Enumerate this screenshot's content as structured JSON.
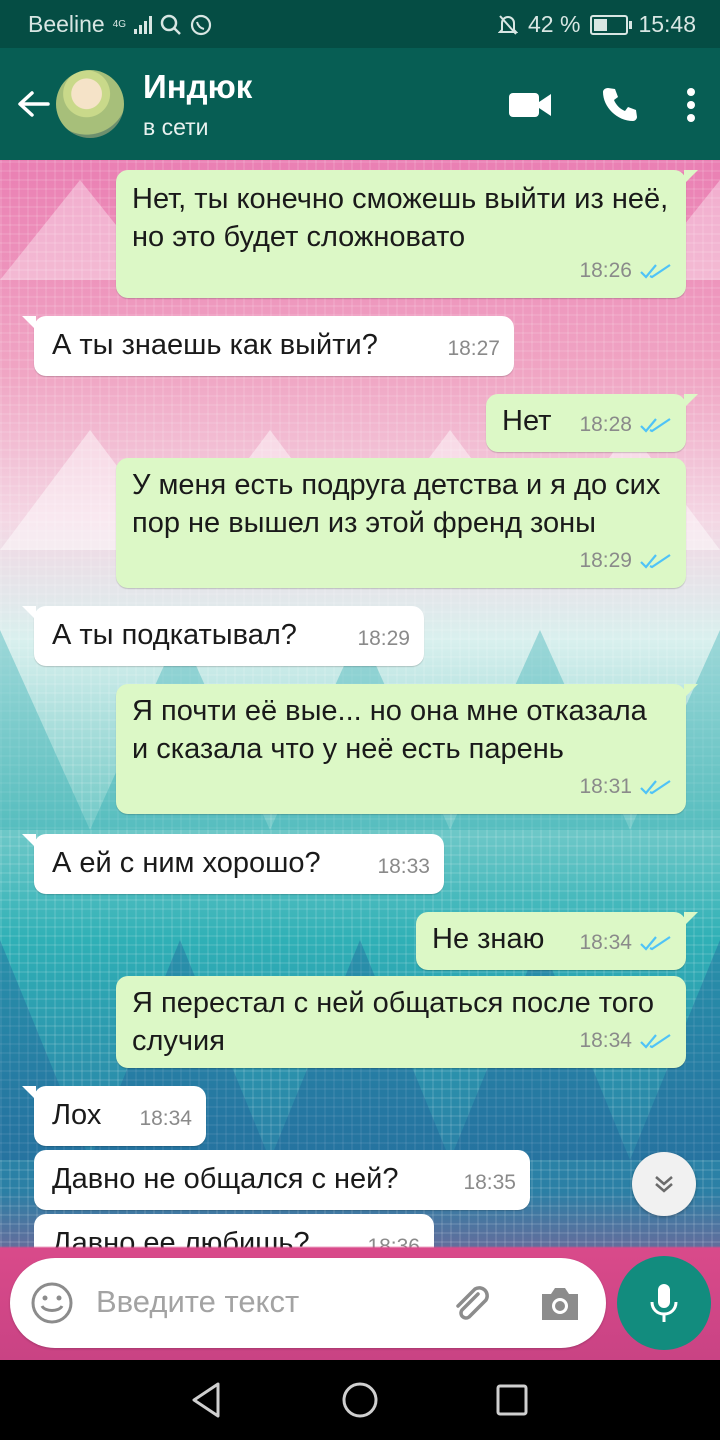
{
  "statusbar": {
    "carrier": "Beeline",
    "network": "4G",
    "battery": "42 %",
    "battery_fraction": 0.42,
    "time": "15:48"
  },
  "header": {
    "contact_name": "Индюк",
    "contact_status": "в сети"
  },
  "messages": [
    {
      "dir": "out",
      "text": "Нет, ты конечно сможешь выйти из неё, но это будет сложновато",
      "time": "18:26",
      "read": true
    },
    {
      "dir": "in",
      "text": "А ты знаешь как выйти?",
      "time": "18:27"
    },
    {
      "dir": "out",
      "text": "Нет",
      "time": "18:28",
      "read": true
    },
    {
      "dir": "out",
      "text": "У меня есть подруга детства и я до сих пор не вышел из этой френд зоны",
      "time": "18:29",
      "read": true
    },
    {
      "dir": "in",
      "text": "А ты подкатывал?",
      "time": "18:29"
    },
    {
      "dir": "out",
      "text": "Я почти её вые... но она мне отказала и сказала что у неё есть парень",
      "time": "18:31",
      "read": true
    },
    {
      "dir": "in",
      "text": "А ей с ним хорошо?",
      "time": "18:33"
    },
    {
      "dir": "out",
      "text": "Не знаю",
      "time": "18:34",
      "read": true
    },
    {
      "dir": "out",
      "text": "Я перестал с ней общаться после того случия",
      "time": "18:34",
      "read": true
    },
    {
      "dir": "in",
      "text": "Лох",
      "time": "18:34"
    },
    {
      "dir": "in",
      "text": "Давно не общался с ней?",
      "time": "18:35"
    },
    {
      "dir": "in",
      "text": "Давно ее любишь?",
      "time": "18:36"
    }
  ],
  "input": {
    "placeholder": "Введите текст"
  },
  "colors": {
    "header": "#075e54",
    "statusbar": "#054d44",
    "outgoing_bubble": "#dcf8c6",
    "incoming_bubble": "#ffffff",
    "read_ticks": "#4fc3f7",
    "mic_button": "#128c7e"
  },
  "icons": [
    "back-arrow-icon",
    "video-call-icon",
    "phone-icon",
    "more-vert-icon",
    "scroll-down-icon",
    "emoji-icon",
    "attach-icon",
    "camera-icon",
    "mic-icon",
    "nav-back-icon",
    "nav-home-icon",
    "nav-recents-icon"
  ]
}
